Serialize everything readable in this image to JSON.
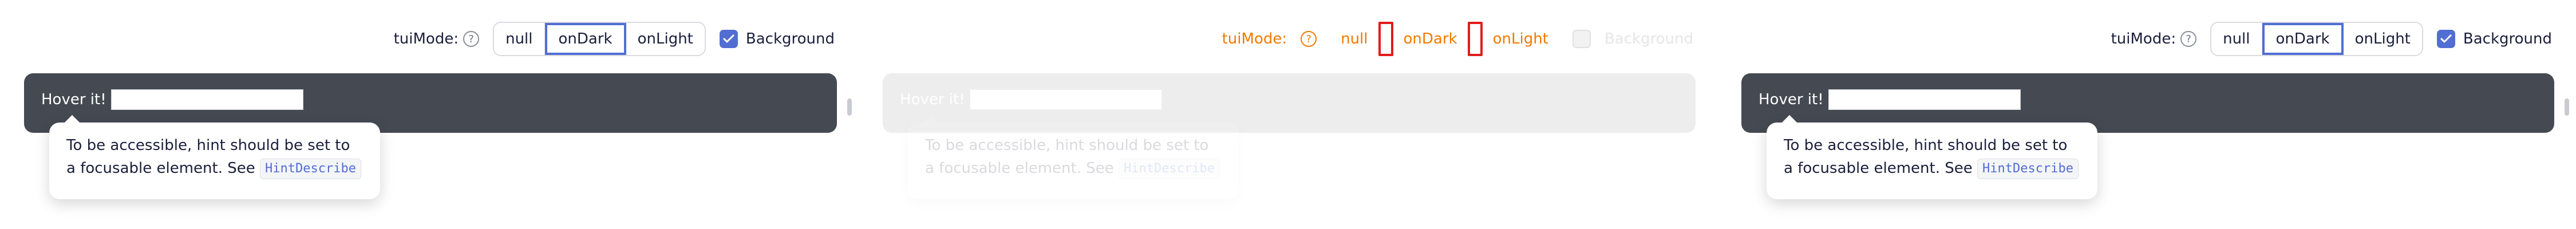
{
  "toolbar": {
    "mode_label": "tuiMode:",
    "options": [
      "null",
      "onDark",
      "onLight"
    ],
    "active_option": "onDark",
    "background_label": "Background",
    "background_checked": true
  },
  "demo": {
    "hover_text": "Hover it!",
    "input_value": ""
  },
  "hint": {
    "text": "To be accessible, hint should be set to a focusable element. See",
    "code": "HintDescribe"
  },
  "colors": {
    "accent": "#526ed3",
    "dark_bg": "#454a52",
    "overlay_orange": "#f07a00",
    "overlay_red": "#e31b1b"
  },
  "icons": {
    "help": "question-circle-icon",
    "check": "check-icon"
  }
}
